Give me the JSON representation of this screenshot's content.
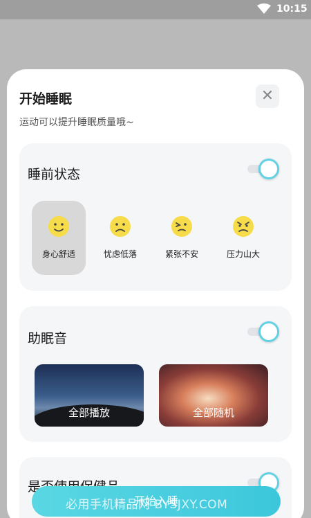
{
  "status_bar": {
    "time": "10:15",
    "wifi_icon": "wifi-icon"
  },
  "sheet": {
    "title": "开始睡眠",
    "subtitle": "运动可以提升睡眠质量哦~",
    "close_icon": "close-icon",
    "close_glyph": "✕"
  },
  "pre_sleep": {
    "title": "睡前状态",
    "toggle_on": true,
    "moods": [
      {
        "label": "身心舒适",
        "icon": "smile-icon",
        "selected": true
      },
      {
        "label": "忧虑低落",
        "icon": "sad-icon",
        "selected": false
      },
      {
        "label": "紧张不安",
        "icon": "nervous-icon",
        "selected": false
      },
      {
        "label": "压力山大",
        "icon": "stressed-icon",
        "selected": false
      }
    ]
  },
  "sleep_sound": {
    "title": "助眠音",
    "toggle_on": true,
    "tiles": [
      {
        "label": "全部播放"
      },
      {
        "label": "全部随机"
      }
    ]
  },
  "third_section": {
    "title": "是否使用保健品",
    "toggle_on": true
  },
  "start_button": {
    "label": "开始入睡"
  },
  "watermark": {
    "text": "必用手机精品网 BYSJXY.COM"
  },
  "colors": {
    "accent": "#5ad7e3",
    "toggle_ring": "#62d1e4",
    "emoji": "#f6dc4a"
  }
}
